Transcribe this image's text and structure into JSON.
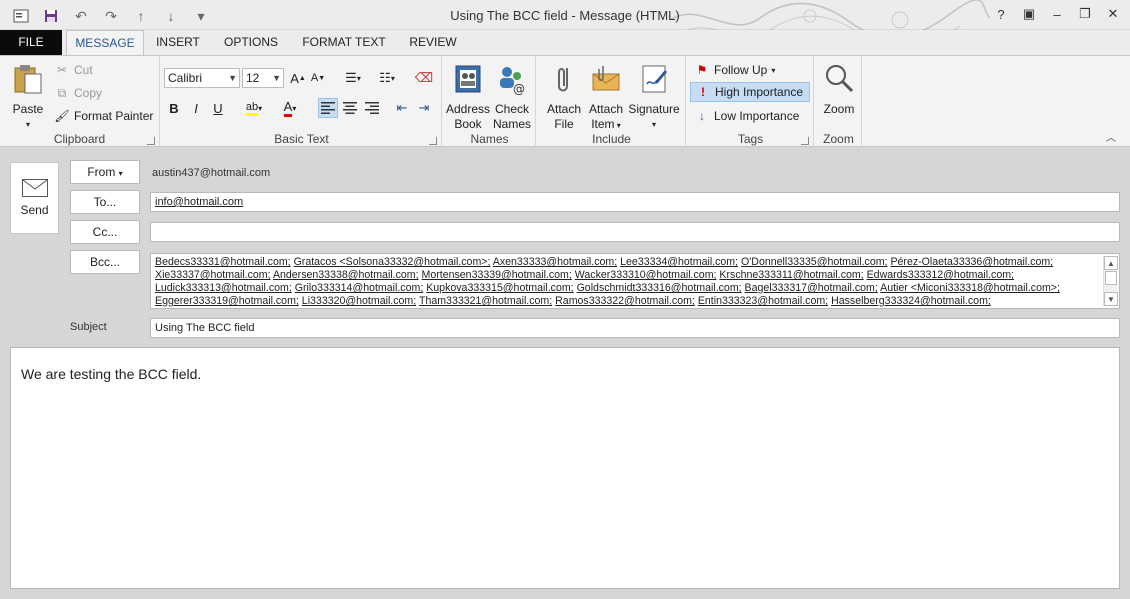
{
  "window": {
    "title": "Using The BCC field - Message (HTML)",
    "controls": {
      "help": "?",
      "ribbon_options": "▣",
      "minimize": "–",
      "restore": "❐",
      "close": "✕"
    }
  },
  "qat": {
    "customize": "▾"
  },
  "tabs": [
    "FILE",
    "MESSAGE",
    "INSERT",
    "OPTIONS",
    "FORMAT TEXT",
    "REVIEW"
  ],
  "active_tab": "MESSAGE",
  "ribbon": {
    "clipboard": {
      "label": "Clipboard",
      "paste": "Paste",
      "cut": "Cut",
      "copy": "Copy",
      "format_painter": "Format Painter"
    },
    "basic_text": {
      "label": "Basic Text",
      "font": "Calibri",
      "size": "12",
      "bold": "B",
      "italic": "I",
      "underline": "U"
    },
    "names": {
      "label": "Names",
      "address_book_1": "Address",
      "address_book_2": "Book",
      "check_names_1": "Check",
      "check_names_2": "Names"
    },
    "include": {
      "label": "Include",
      "attach_file_1": "Attach",
      "attach_file_2": "File",
      "attach_item_1": "Attach",
      "attach_item_2": "Item",
      "signature": "Signature"
    },
    "tags": {
      "label": "Tags",
      "follow_up": "Follow Up",
      "high_importance": "High Importance",
      "low_importance": "Low Importance"
    },
    "zoom": {
      "label": "Zoom",
      "zoom": "Zoom"
    }
  },
  "compose": {
    "send": "Send",
    "from_label": "From",
    "from_value": "austin437@hotmail.com",
    "to_label": "To...",
    "to_value": "info@hotmail.com",
    "cc_label": "Cc...",
    "cc_value": "",
    "bcc_label": "Bcc...",
    "bcc_lines": [
      [
        "Bedecs33331@hotmail.com;",
        "Gratacos <Solsona33332@hotmail.com>;",
        "Axen33333@hotmail.com;",
        "Lee33334@hotmail.com;",
        "O'Donnell33335@hotmail.com;",
        "Pérez-Olaeta33336@hotmail.com;"
      ],
      [
        "Xie33337@hotmail.com;",
        "Andersen33338@hotmail.com;",
        "Mortensen33339@hotmail.com;",
        "Wacker333310@hotmail.com;",
        "Krschne333311@hotmail.com;",
        "Edwards333312@hotmail.com;"
      ],
      [
        "Ludick333313@hotmail.com;",
        "Grilo333314@hotmail.com;",
        "Kupkova333315@hotmail.com;",
        "Goldschmidt333316@hotmail.com;",
        "Bagel333317@hotmail.com;",
        "Autier <Miconi333318@hotmail.com>;"
      ],
      [
        "Eggerer333319@hotmail.com;",
        "Li333320@hotmail.com;",
        "Tham333321@hotmail.com;",
        "Ramos333322@hotmail.com;",
        "Entin333323@hotmail.com;",
        "Hasselberg333324@hotmail.com;"
      ]
    ],
    "subject_label": "Subject",
    "subject_value": "Using The BCC field",
    "body": "We are testing the BCC field."
  }
}
